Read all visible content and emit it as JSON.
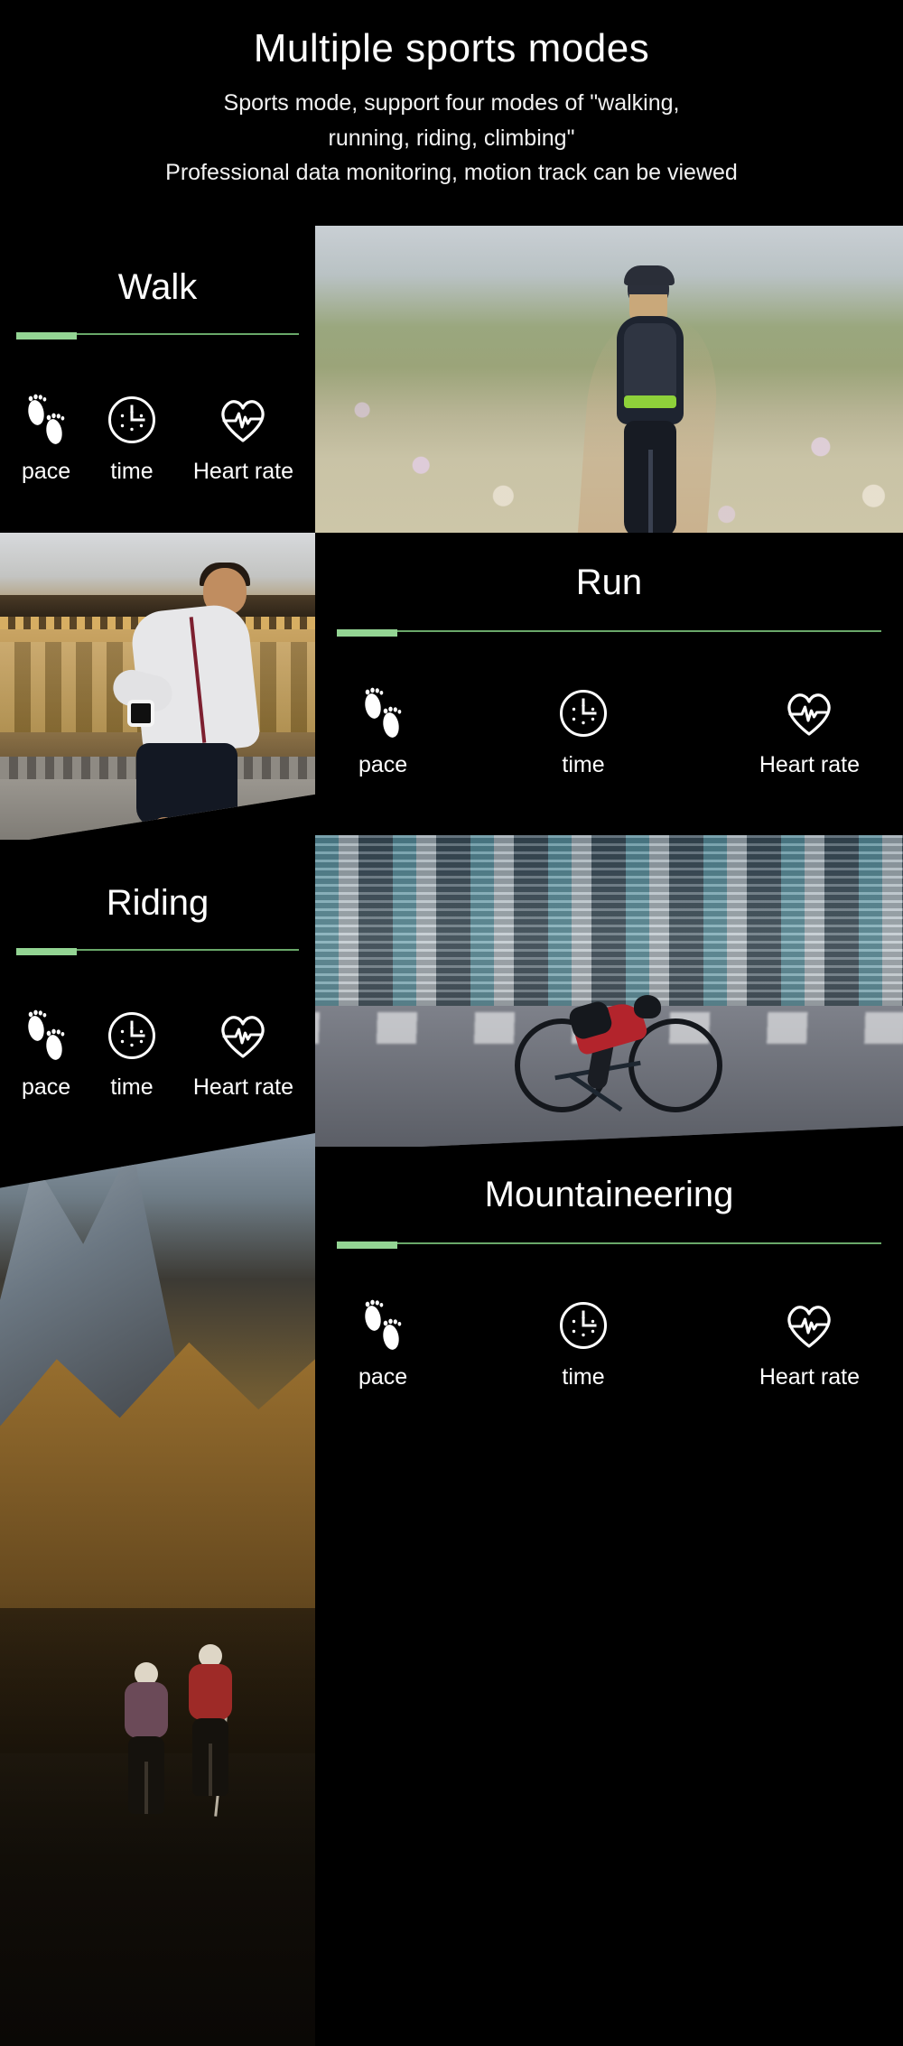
{
  "header": {
    "title": "Multiple sports modes",
    "subtitle_lines": [
      "Sports mode, support four modes of \"walking,",
      "running, riding, climbing\"",
      "Professional data monitoring, motion track can be viewed"
    ]
  },
  "accent": {
    "green_bright": "#93d493",
    "green_line": "#69a869",
    "background": "#000000",
    "text": "#ffffff"
  },
  "metrics": {
    "pace": {
      "label": "pace",
      "icon": "footprints-icon"
    },
    "time": {
      "label": "time",
      "icon": "clock-icon"
    },
    "heart": {
      "label": "Heart rate",
      "icon": "heart-rate-icon"
    }
  },
  "sections": [
    {
      "id": "walk",
      "title": "Walk",
      "text_side": "left",
      "image_name": "walking-woman-flower-field-photo",
      "metrics": [
        {
          "label": "pace",
          "icon": "footprints-icon"
        },
        {
          "label": "time",
          "icon": "clock-icon"
        },
        {
          "label": "Heart rate",
          "icon": "heart-rate-icon"
        }
      ]
    },
    {
      "id": "run",
      "title": "Run",
      "text_side": "right",
      "image_name": "running-man-classical-building-photo",
      "metrics": [
        {
          "label": "pace",
          "icon": "footprints-icon"
        },
        {
          "label": "time",
          "icon": "clock-icon"
        },
        {
          "label": "Heart rate",
          "icon": "heart-rate-icon"
        }
      ]
    },
    {
      "id": "riding",
      "title": "Riding",
      "text_side": "left",
      "image_name": "cyclist-city-motion-blur-photo",
      "metrics": [
        {
          "label": "pace",
          "icon": "footprints-icon"
        },
        {
          "label": "time",
          "icon": "clock-icon"
        },
        {
          "label": "Heart rate",
          "icon": "heart-rate-icon"
        }
      ]
    },
    {
      "id": "mountaineering",
      "title": "Mountaineering",
      "text_side": "right",
      "image_name": "two-hikers-mountain-ridge-photo",
      "metrics": [
        {
          "label": "pace",
          "icon": "footprints-icon"
        },
        {
          "label": "time",
          "icon": "clock-icon"
        },
        {
          "label": "Heart rate",
          "icon": "heart-rate-icon"
        }
      ]
    }
  ]
}
